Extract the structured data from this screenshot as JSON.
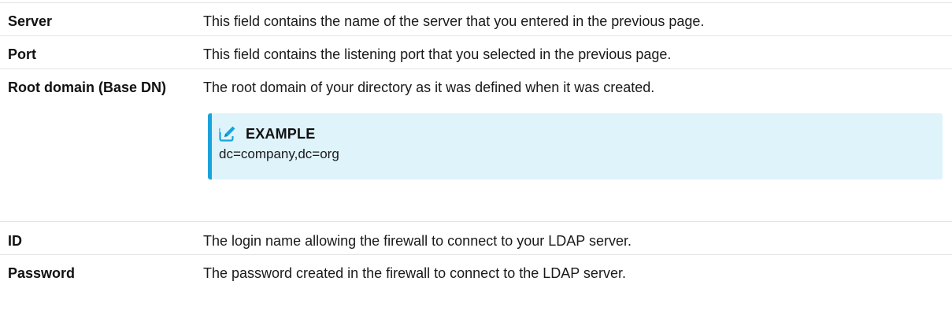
{
  "rows": [
    {
      "label": "Server",
      "description": "This field contains the name of the server that you entered in the previous page."
    },
    {
      "label": "Port",
      "description": "This field contains the listening port that you selected in the previous page."
    },
    {
      "label": "Root domain (Base DN)",
      "description": "The root domain of your directory as it was defined when it was created.",
      "example": {
        "icon": "edit-icon",
        "title": "EXAMPLE",
        "value": "dc=company,dc=org"
      }
    },
    {
      "label": "ID",
      "description": "The login name allowing the firewall to connect to your LDAP server."
    },
    {
      "label": "Password",
      "description": "The password created in the firewall to connect to the LDAP server."
    }
  ],
  "colors": {
    "example_background": "#dff3fb",
    "example_accent": "#1aa3dd",
    "row_divider": "#e3e3e3"
  }
}
